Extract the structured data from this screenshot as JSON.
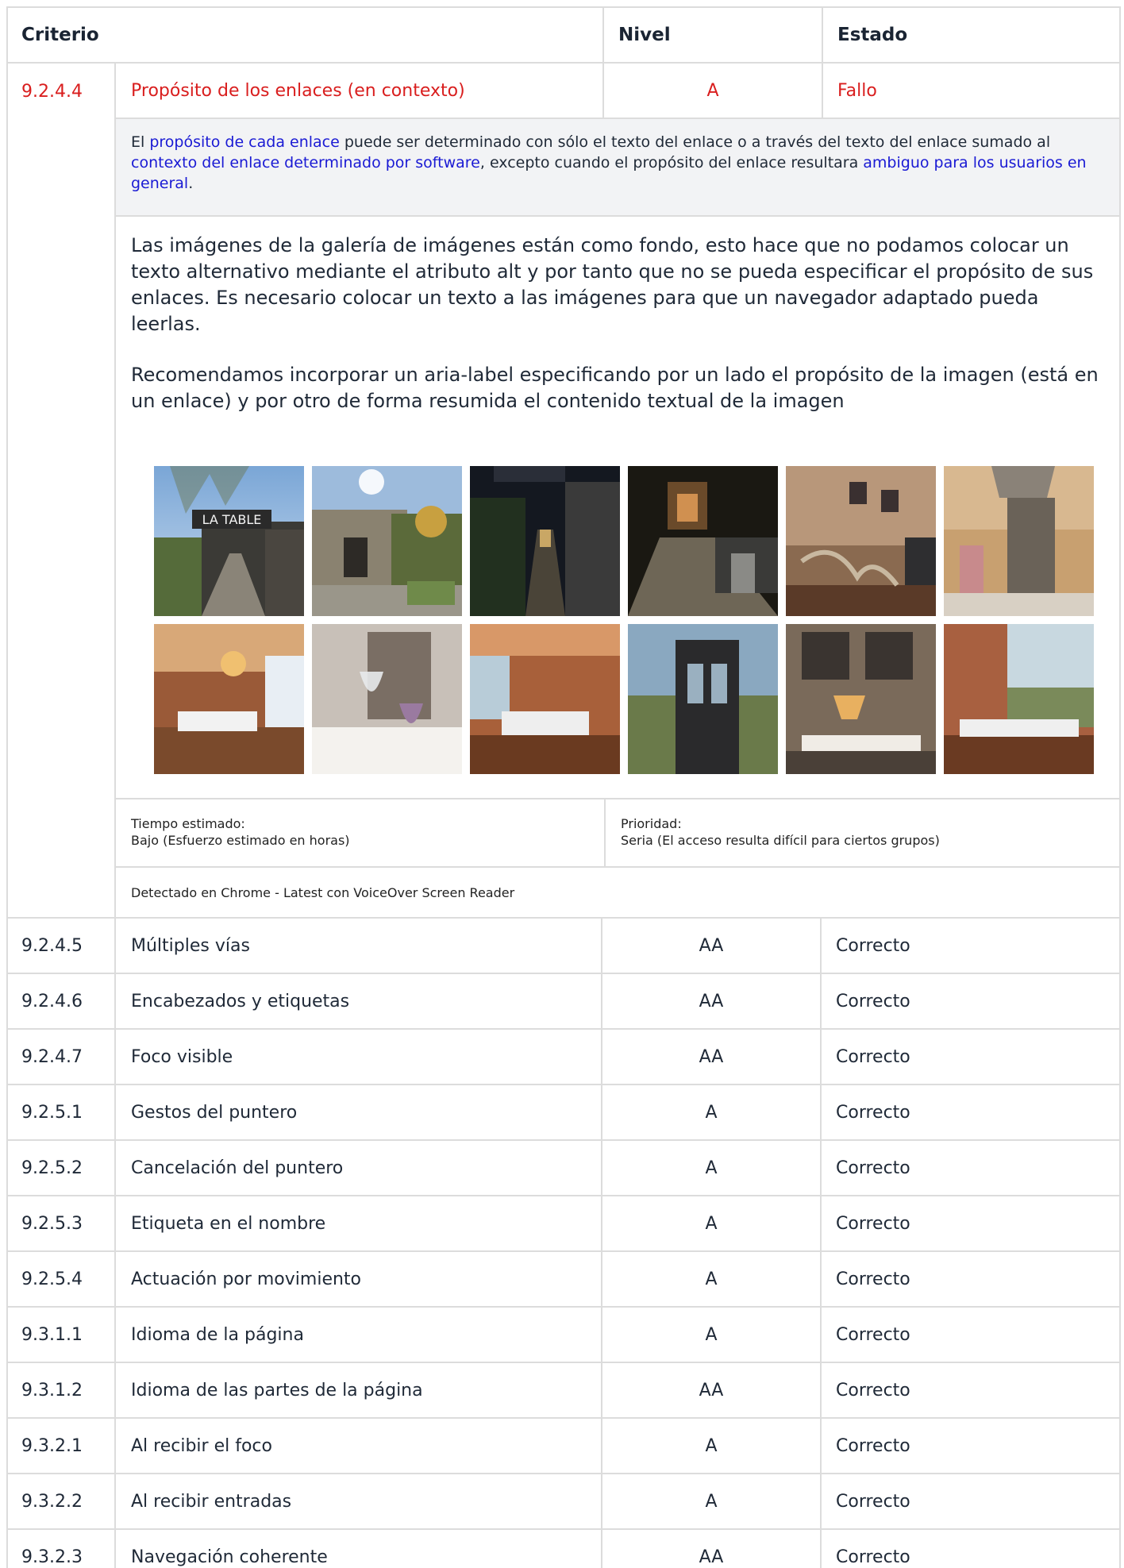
{
  "header": {
    "criterio": "Criterio",
    "nivel": "Nivel",
    "estado": "Estado"
  },
  "failed": {
    "code": "9.2.4.4",
    "name": "Propósito de los enlaces (en contexto)",
    "level": "A",
    "state": "Fallo",
    "definition": {
      "t1": "El ",
      "l1": "propósito de cada enlace",
      "t2": " puede ser determinado con sólo el texto del enlace o a través del texto del enlace sumado al ",
      "l2": "contexto del enlace determinado por software",
      "t3": ", excepto cuando el propósito del enlace resultara ",
      "l3": "ambiguo para los usuarios en general",
      "t4": "."
    },
    "paragraph1": "Las imágenes de la galería de imágenes están como fondo, esto hace que no podamos colocar un texto alternativo mediante el atributo alt y por tanto que no se pueda especificar el propósito de sus enlaces. Es necesario colocar un texto a las imágenes para que un navegador adaptado pueda leerlas.",
    "paragraph2": "Recomendamos incorporar un aria-label especificando por un lado el propósito de la imagen (está en un enlace) y por otro de forma resumida el contenido textual de la imagen",
    "gallery_sign": "LA TABLE",
    "time_label": "Tiempo estimado:",
    "time_value": "Bajo (Esfuerzo estimado en horas)",
    "priority_label": "Prioridad:",
    "priority_value": "Seria (El acceso resulta difícil para ciertos grupos)",
    "detected": "Detectado en Chrome - Latest con VoiceOver Screen Reader"
  },
  "rows": [
    {
      "code": "9.2.4.5",
      "name": "Múltiples vías",
      "level": "AA",
      "state": "Correcto"
    },
    {
      "code": "9.2.4.6",
      "name": "Encabezados y etiquetas",
      "level": "AA",
      "state": "Correcto"
    },
    {
      "code": "9.2.4.7",
      "name": "Foco visible",
      "level": "AA",
      "state": "Correcto"
    },
    {
      "code": "9.2.5.1",
      "name": "Gestos del puntero",
      "level": "A",
      "state": "Correcto"
    },
    {
      "code": "9.2.5.2",
      "name": "Cancelación del puntero",
      "level": "A",
      "state": "Correcto"
    },
    {
      "code": "9.2.5.3",
      "name": "Etiqueta en el nombre",
      "level": "A",
      "state": "Correcto"
    },
    {
      "code": "9.2.5.4",
      "name": "Actuación por movimiento",
      "level": "A",
      "state": "Correcto"
    },
    {
      "code": "9.3.1.1",
      "name": "Idioma de la página",
      "level": "A",
      "state": "Correcto"
    },
    {
      "code": "9.3.1.2",
      "name": "Idioma de las partes de la página",
      "level": "AA",
      "state": "Correcto"
    },
    {
      "code": "9.3.2.1",
      "name": "Al recibir el foco",
      "level": "A",
      "state": "Correcto"
    },
    {
      "code": "9.3.2.2",
      "name": "Al recibir entradas",
      "level": "A",
      "state": "Correcto"
    },
    {
      "code": "9.3.2.3",
      "name": "Navegación coherente",
      "level": "AA",
      "state": "Correcto"
    }
  ]
}
